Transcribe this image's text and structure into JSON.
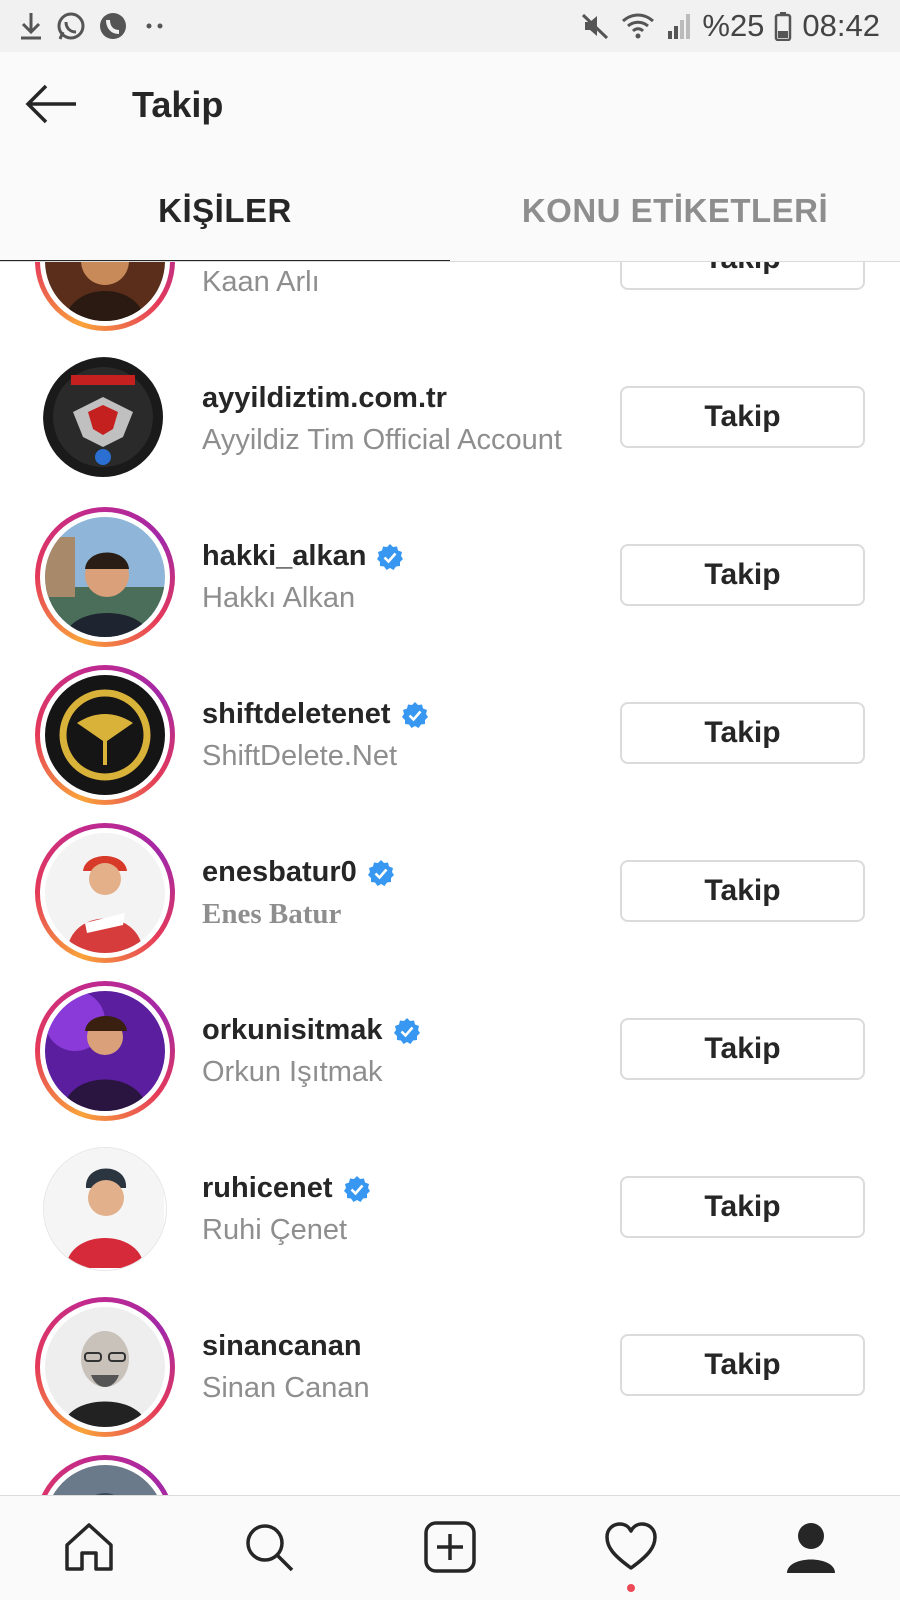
{
  "status_bar": {
    "battery_percent": "%25",
    "time": "08:42",
    "left_icons": [
      "download-icon",
      "whatsapp-icon",
      "phone-icon",
      "more-dots-icon"
    ],
    "right_icons": [
      "mute-icon",
      "wifi-icon",
      "signal-icon",
      "battery-icon"
    ]
  },
  "header": {
    "title": "Takip",
    "back_icon": "arrow-left-icon"
  },
  "tabs": [
    {
      "label": "KİŞİLER",
      "active": true
    },
    {
      "label": "KONU ETİKETLERİ",
      "active": false
    }
  ],
  "list": {
    "items": [
      {
        "username": "",
        "full_name": "Kaan Arlı",
        "verified": false,
        "story_ring": true,
        "button": "Takip"
      },
      {
        "username": "ayyildiztim.com.tr",
        "full_name": "Ayyildiz Tim Official Account",
        "verified": false,
        "story_ring": false,
        "button": "Takip"
      },
      {
        "username": "hakki_alkan",
        "full_name": "Hakkı Alkan",
        "verified": true,
        "story_ring": true,
        "button": "Takip"
      },
      {
        "username": "shiftdeletenet",
        "full_name": "ShiftDelete.Net",
        "verified": true,
        "story_ring": true,
        "button": "Takip"
      },
      {
        "username": "enesbatur0",
        "full_name": "Enes Batur",
        "verified": true,
        "story_ring": true,
        "button": "Takip"
      },
      {
        "username": "orkunisitmak",
        "full_name": "Orkun Işıtmak",
        "verified": true,
        "story_ring": true,
        "button": "Takip"
      },
      {
        "username": "ruhicenet",
        "full_name": "Ruhi Çenet",
        "verified": true,
        "story_ring": false,
        "button": "Takip"
      },
      {
        "username": "sinancanan",
        "full_name": "Sinan Canan",
        "verified": false,
        "story_ring": true,
        "button": "Takip"
      }
    ]
  },
  "bottom_nav": [
    {
      "icon": "home-icon"
    },
    {
      "icon": "search-icon"
    },
    {
      "icon": "new-post-icon"
    },
    {
      "icon": "activity-heart-icon"
    },
    {
      "icon": "profile-icon"
    }
  ],
  "colors": {
    "verified_blue": "#3897f0",
    "text_primary": "#262626",
    "text_secondary": "#8e8e8e",
    "notification_dot": "#ed4956",
    "border": "#dbdbdb"
  }
}
